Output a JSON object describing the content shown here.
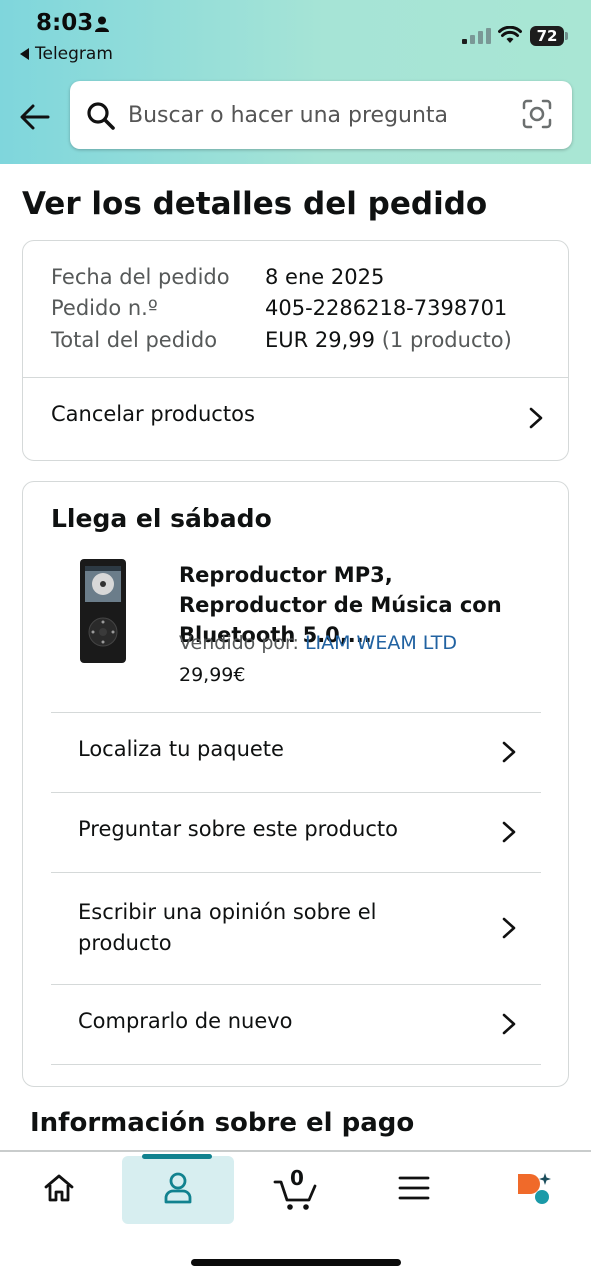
{
  "status_bar": {
    "time": "8:03",
    "back_app": "Telegram",
    "battery": "72"
  },
  "search": {
    "placeholder": "Buscar o hacer una pregunta"
  },
  "page_title": "Ver los detalles del pedido",
  "order_summary": {
    "rows": [
      {
        "label": "Fecha del pedido",
        "value": "8 ene 2025"
      },
      {
        "label": "Pedido n.º",
        "value": "405-2286218-7398701"
      },
      {
        "label": "Total del pedido",
        "value": "EUR 29,99",
        "extra": "(1 producto)"
      }
    ],
    "cancel_label": "Cancelar productos"
  },
  "shipment": {
    "arrival": "Llega el sábado",
    "product": {
      "title": "Reproductor MP3, Reproductor de Música con Bluetooth 5.0,...",
      "seller_prefix": "Vendido por:",
      "seller_name": "LIAM WEAM LTD",
      "price": "29,99€"
    },
    "actions": [
      {
        "label": "Localiza tu paquete"
      },
      {
        "label": "Preguntar sobre este producto"
      },
      {
        "label": "Escribir una opinión sobre el producto"
      },
      {
        "label": "Comprarlo de nuevo"
      }
    ]
  },
  "payment_section_title": "Información sobre el pago",
  "bottom_nav": {
    "items": [
      {
        "icon": "home-icon"
      },
      {
        "icon": "account-icon",
        "active": true
      },
      {
        "icon": "cart-icon",
        "count": "0"
      },
      {
        "icon": "menu-icon"
      },
      {
        "icon": "rufus-ai-icon"
      }
    ]
  },
  "colors": {
    "header_gradient_start": "#7fd6dc",
    "header_gradient_end": "#a9e6d4",
    "link": "#2162a1",
    "active_nav": "#11828f",
    "ai_orange": "#f06a2a",
    "ai_teal": "#1b9aa8"
  }
}
